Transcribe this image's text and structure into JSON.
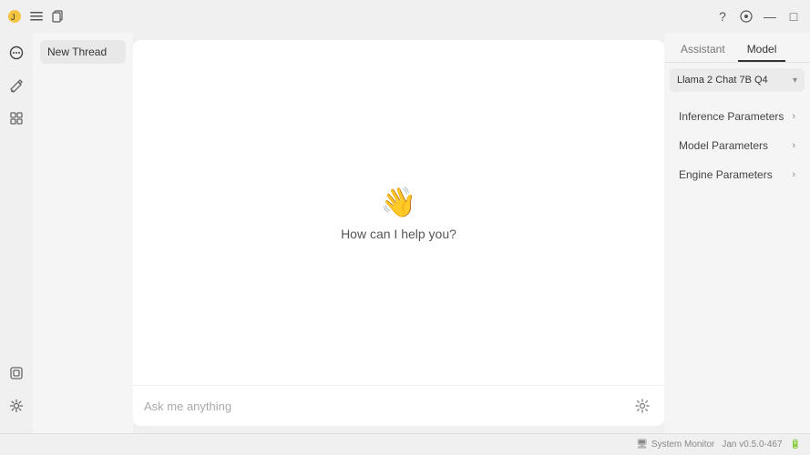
{
  "titlebar": {
    "app_icon": "🟡",
    "controls": {
      "minimize": "—",
      "maximize": "□",
      "close": "✕"
    }
  },
  "icon_sidebar": {
    "top_icons": [
      {
        "name": "chat-icon",
        "symbol": "💬"
      },
      {
        "name": "edit-icon",
        "symbol": "✏️"
      },
      {
        "name": "grid-icon",
        "symbol": "⊞"
      }
    ],
    "bottom_icons": [
      {
        "name": "layers-icon",
        "symbol": "⧉"
      },
      {
        "name": "settings-icon",
        "symbol": "⚙"
      }
    ]
  },
  "thread_panel": {
    "items": [
      {
        "label": "New Thread"
      }
    ]
  },
  "chat": {
    "welcome_emoji": "👋",
    "welcome_text": "How can I help you?",
    "input_placeholder": "Ask me anything"
  },
  "right_panel": {
    "tabs": [
      {
        "label": "Assistant",
        "active": false
      },
      {
        "label": "Model",
        "active": true
      }
    ],
    "model_selector": {
      "value": "Llama 2 Chat 7B Q4"
    },
    "sections": [
      {
        "label": "Inference Parameters"
      },
      {
        "label": "Model Parameters"
      },
      {
        "label": "Engine Parameters"
      }
    ]
  },
  "status_bar": {
    "system_monitor_icon": "🖥",
    "system_monitor_label": "System Monitor",
    "version": "Jan v0.5.0-467",
    "battery_icon": "🔋"
  }
}
